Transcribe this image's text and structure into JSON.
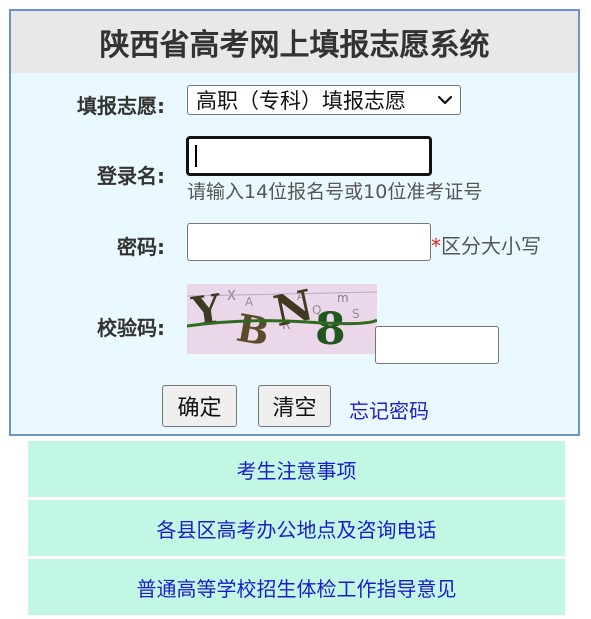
{
  "title": "陕西省高考网上填报志愿系统",
  "form": {
    "choice_label": "填报志愿:",
    "choice_selected": "高职（专科）填报志愿",
    "username_label": "登录名:",
    "username_value": "",
    "username_hint": "请输入14位报名号或10位准考证号",
    "password_label": "密码:",
    "password_value": "",
    "password_star": "*",
    "password_hint": "区分大小写",
    "captcha_label": "校验码:",
    "captcha_text": "YBN8",
    "captcha_value": ""
  },
  "buttons": {
    "confirm": "确定",
    "clear": "清空",
    "forgot": "忘记密码"
  },
  "notices": [
    "考生注意事项",
    "各县区高考办公地点及咨询电话",
    "普通高等学校招生体检工作指导意见"
  ],
  "colors": {
    "panel_bg": "#eaf9ff",
    "panel_border": "#6f92c9",
    "title_bg": "#e8e8e8",
    "notice_bg": "#c2f7e3",
    "link": "#1b1bd0",
    "required": "#e02020"
  },
  "icons": {
    "select_arrow": "chevron-down-icon"
  }
}
